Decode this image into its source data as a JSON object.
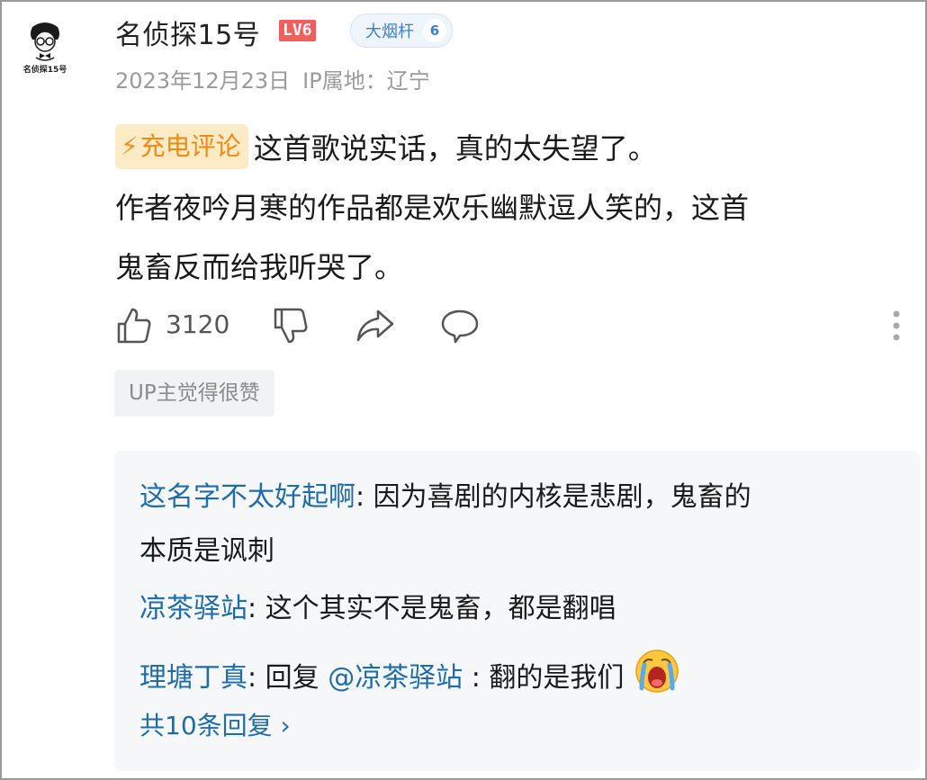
{
  "user": {
    "avatar_caption": "名侦探15号",
    "name": "名侦探15号",
    "level": "LV6",
    "medal_name": "大烟杆",
    "medal_level": "6"
  },
  "meta": {
    "date": "2023年12月23日",
    "ip": "IP属地：辽宁"
  },
  "comment": {
    "badge": "充电评论",
    "line1": "这首歌说实话，真的太失望了。",
    "line2": "作者夜吟月寒的作品都是欢乐幽默逗人笑的，这首",
    "line3": "鬼畜反而给我听哭了。"
  },
  "actions": {
    "like_count": "3120"
  },
  "up_tag": "UP主觉得很赞",
  "replies": [
    {
      "user": "这名字不太好起啊",
      "text_line1": ": 因为喜剧的内核是悲剧，鬼畜的",
      "text_line2": "本质是讽刺"
    },
    {
      "user": "凉茶驿站",
      "text": ": 这个其实不是鬼畜，都是翻唱"
    },
    {
      "user": "理塘丁真",
      "text_pre": ": 回复 ",
      "mention": "@凉茶驿站",
      "text_post": " : 翻的是我们",
      "emoji": "crying-face"
    }
  ],
  "more_replies": "共10条回复 ›",
  "icons": [
    "thumbs-up-icon",
    "thumbs-down-icon",
    "share-icon",
    "reply-icon",
    "more-vertical-icon",
    "crying-face-icon"
  ],
  "colors": {
    "link_blue": "#1f6da8",
    "level_red": "#f25d5d",
    "badge_orange": "#ef8a15",
    "meta_gray": "#9a9a9a"
  }
}
